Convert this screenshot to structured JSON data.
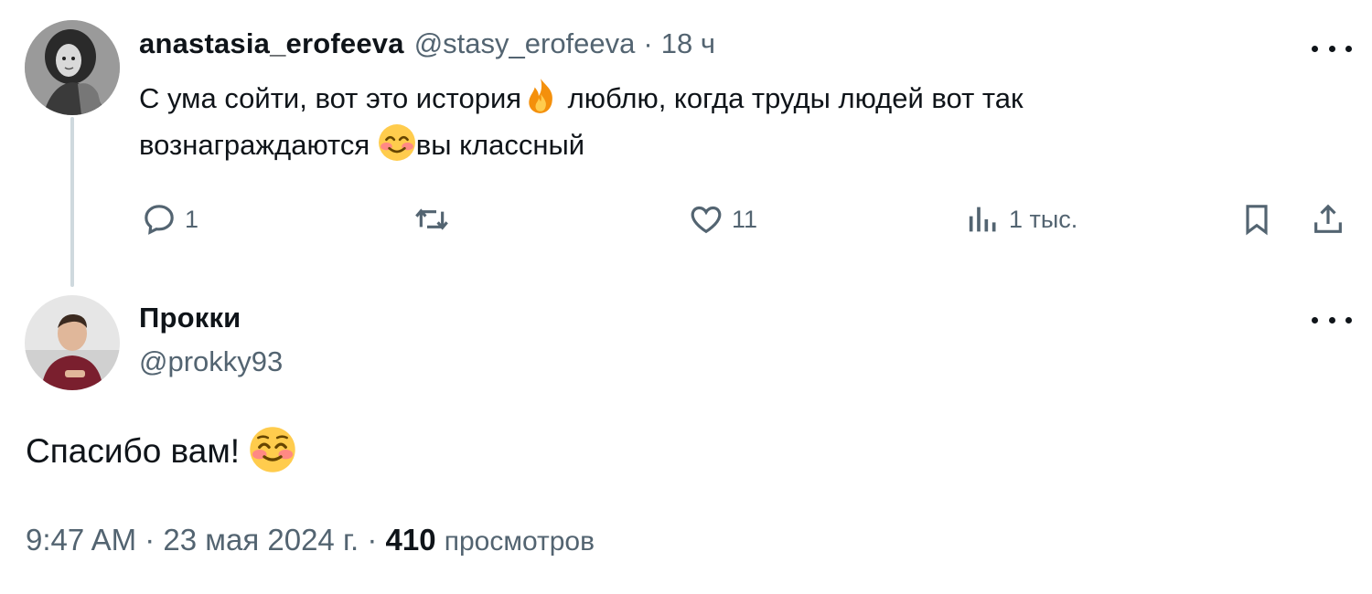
{
  "reply": {
    "display_name": "anastasia_erofeeva",
    "handle": "@stasy_erofeeva",
    "separator": "·",
    "time": "18 ч",
    "text_line1_a": "С ума сойти, вот это история",
    "text_line1_b": " люблю, когда труды людей вот так",
    "text_line2_a": "вознаграждаются ",
    "text_line2_b": "вы классный",
    "emoji_fire": "fire-emoji",
    "emoji_smile": "smiling-face-with-smiling-eyes-emoji",
    "actions": {
      "replies": "1",
      "retweets": "",
      "likes": "11",
      "views": "1 тыс."
    }
  },
  "main_tweet": {
    "display_name": "Прокки",
    "handle": "@prokky93",
    "text": "Спасибо вам! ",
    "emoji": "smiling-face-emoji",
    "meta": {
      "time": "9:47 AM",
      "date": "23 мая 2024 г.",
      "separator": "·",
      "views_count": "410",
      "views_label": "просмотров"
    }
  },
  "colors": {
    "text_primary": "#0f1419",
    "text_secondary": "#536471",
    "thread_line": "#cfd9de"
  }
}
